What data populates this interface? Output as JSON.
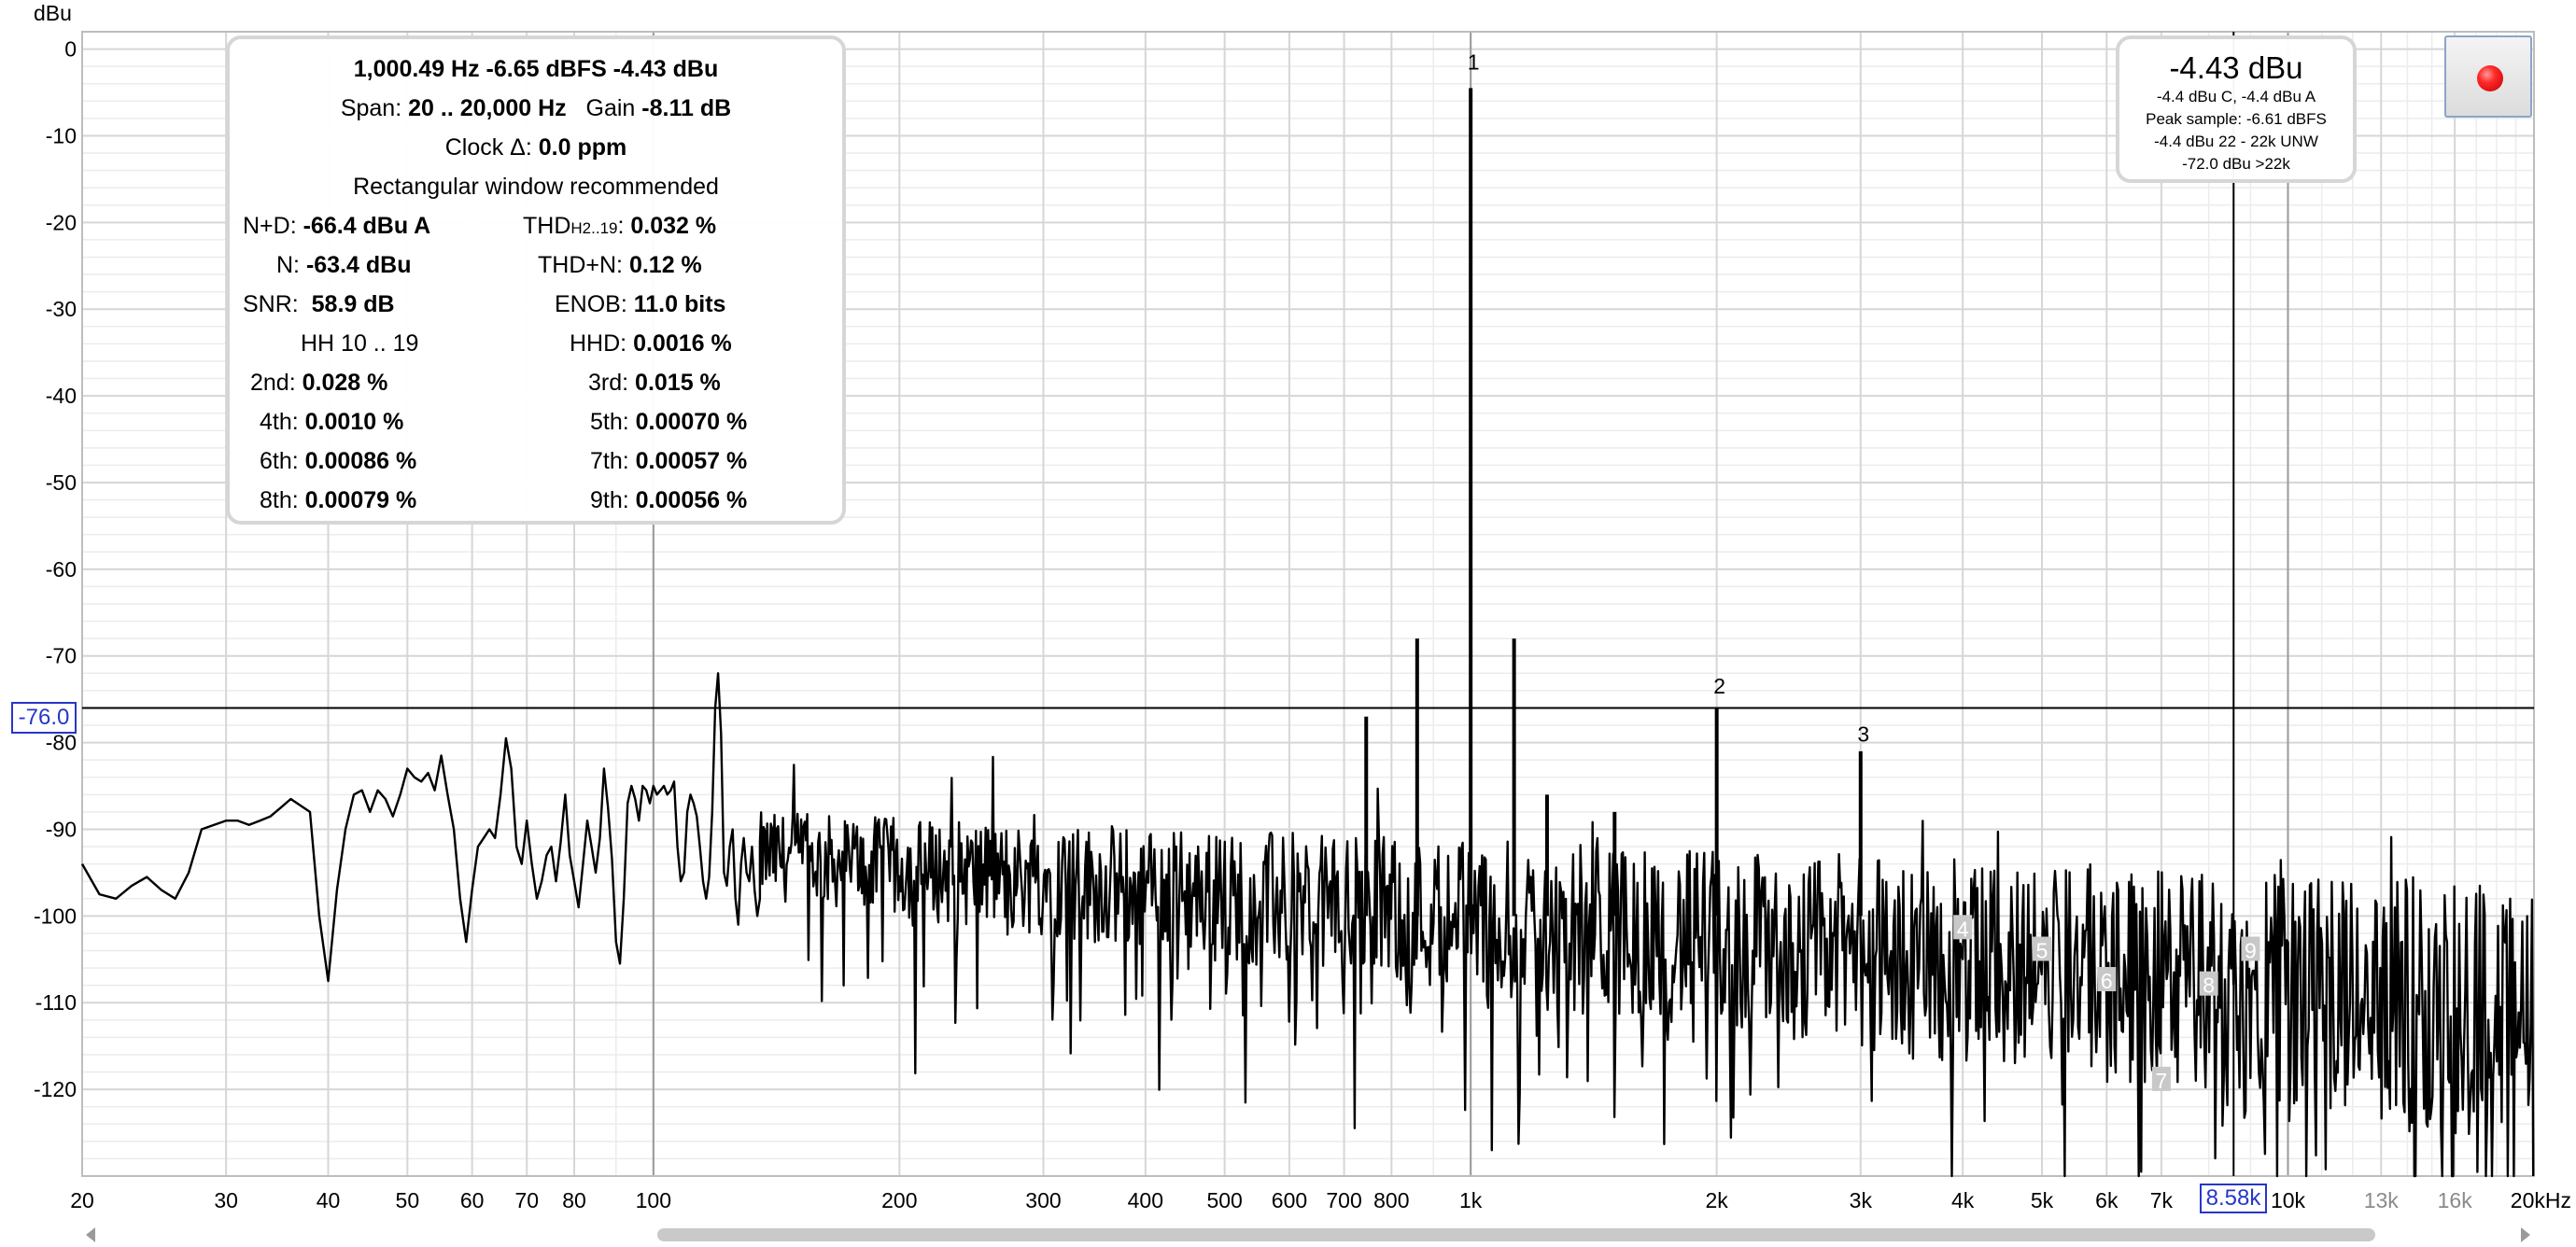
{
  "y_unit": "dBu",
  "stats": {
    "header": "1,000.49 Hz  -6.65 dBFS  -4.43 dBu",
    "span_label": "Span:",
    "span_value": "20 .. 20,000 Hz",
    "gain_label": "Gain",
    "gain_value": "-8.11 dB",
    "clock_label": "Clock Δ:",
    "clock_value": "0.0 ppm",
    "note": "Rectangular window recommended",
    "left": [
      {
        "label": "N+D:",
        "value": "-66.4 dBu A"
      },
      {
        "label": "N:",
        "value": "-63.4 dBu"
      },
      {
        "label": "SNR:",
        "value": "58.9 dB"
      },
      {
        "label": "HH 10 .. 19",
        "value": ""
      },
      {
        "label": "2nd:",
        "value": "0.028 %"
      },
      {
        "label": "4th:",
        "value": "0.0010 %"
      },
      {
        "label": "6th:",
        "value": "0.00086 %"
      },
      {
        "label": "8th:",
        "value": "0.00079 %"
      }
    ],
    "right_thd_label": "THD",
    "right_thd_sub": "H2..19",
    "right_thd_colon": ":",
    "right": [
      {
        "label": "",
        "value": "0.032 %"
      },
      {
        "label": "THD+N:",
        "value": "0.12 %"
      },
      {
        "label": "ENOB:",
        "value": "11.0 bits"
      },
      {
        "label": "HHD:",
        "value": "0.0016 %"
      },
      {
        "label": "3rd:",
        "value": "0.015 %"
      },
      {
        "label": "5th:",
        "value": "0.00070 %"
      },
      {
        "label": "7th:",
        "value": "0.00057 %"
      },
      {
        "label": "9th:",
        "value": "0.00056 %"
      }
    ]
  },
  "meter": {
    "level": "-4.43 dBu",
    "line1": "-4.4 dBu C, -4.4 dBu A",
    "line2": "Peak sample: -6.61 dBFS",
    "line3": "-4.4 dBu 22 - 22k UNW",
    "line4": "-72.0 dBu >22k"
  },
  "cursor": {
    "y_label": "-76.0",
    "x_label": "8.58k",
    "y_value": -76.0,
    "x_value": 8580
  },
  "chart_data": {
    "type": "line",
    "xlabel": "",
    "ylabel": "dBu",
    "xscale": "log",
    "xlim": [
      20,
      20000
    ],
    "ylim": [
      -130,
      2
    ],
    "grid": true,
    "x_ticks": [
      {
        "v": 20,
        "t": "20"
      },
      {
        "v": 30,
        "t": "30"
      },
      {
        "v": 40,
        "t": "40"
      },
      {
        "v": 50,
        "t": "50"
      },
      {
        "v": 60,
        "t": "60"
      },
      {
        "v": 70,
        "t": "70"
      },
      {
        "v": 80,
        "t": "80"
      },
      {
        "v": 100,
        "t": "100"
      },
      {
        "v": 200,
        "t": "200"
      },
      {
        "v": 300,
        "t": "300"
      },
      {
        "v": 400,
        "t": "400"
      },
      {
        "v": 500,
        "t": "500"
      },
      {
        "v": 600,
        "t": "600"
      },
      {
        "v": 700,
        "t": "700"
      },
      {
        "v": 800,
        "t": "800"
      },
      {
        "v": 1000,
        "t": "1k"
      },
      {
        "v": 2000,
        "t": "2k"
      },
      {
        "v": 3000,
        "t": "3k"
      },
      {
        "v": 4000,
        "t": "4k"
      },
      {
        "v": 5000,
        "t": "5k"
      },
      {
        "v": 6000,
        "t": "6k"
      },
      {
        "v": 7000,
        "t": "7k"
      },
      {
        "v": 10000,
        "t": "10k"
      },
      {
        "v": 13000,
        "t": "13k",
        "gray": true
      },
      {
        "v": 16000,
        "t": "16k",
        "gray": true
      },
      {
        "v": 20000,
        "t": "20kHz"
      }
    ],
    "y_ticks": [
      0,
      -10,
      -20,
      -30,
      -40,
      -50,
      -60,
      -70,
      -80,
      -90,
      -100,
      -110,
      -120
    ],
    "harmonic_labels": [
      {
        "n": "1",
        "f": 1000,
        "db": -1.5,
        "boxed": false
      },
      {
        "n": "2",
        "f": 2000,
        "db": -73.5,
        "boxed": false
      },
      {
        "n": "3",
        "f": 3000,
        "db": -79.0,
        "boxed": false
      },
      {
        "n": "4",
        "f": 4000,
        "db": -101.5,
        "boxed": true
      },
      {
        "n": "5",
        "f": 5000,
        "db": -104.0,
        "boxed": true
      },
      {
        "n": "6",
        "f": 6000,
        "db": -107.5,
        "boxed": true
      },
      {
        "n": "7",
        "f": 7000,
        "db": -119.0,
        "boxed": true
      },
      {
        "n": "8",
        "f": 8000,
        "db": -108.0,
        "boxed": true
      },
      {
        "n": "9",
        "f": 9000,
        "db": -104.0,
        "boxed": true
      }
    ],
    "series": [
      {
        "values": [
          [
            20,
            -94
          ],
          [
            21,
            -97.5
          ],
          [
            22,
            -98
          ],
          [
            23,
            -96.5
          ],
          [
            24,
            -95.5
          ],
          [
            25,
            -97
          ],
          [
            26,
            -98
          ],
          [
            27,
            -95
          ],
          [
            28,
            -90
          ],
          [
            29,
            -89.5
          ],
          [
            30,
            -89
          ],
          [
            31,
            -89
          ],
          [
            32,
            -89.5
          ],
          [
            33,
            -89
          ],
          [
            34,
            -88.5
          ],
          [
            35,
            -87.5
          ],
          [
            36,
            -86.5
          ],
          [
            38,
            -88
          ],
          [
            39,
            -100
          ],
          [
            40,
            -107.5
          ],
          [
            41,
            -97
          ],
          [
            42,
            -90
          ],
          [
            43,
            -86
          ],
          [
            44,
            -85.5
          ],
          [
            45,
            -88
          ],
          [
            46,
            -85.5
          ],
          [
            47,
            -86.5
          ],
          [
            48,
            -88.5
          ],
          [
            49,
            -86
          ],
          [
            50,
            -83
          ],
          [
            51,
            -84
          ],
          [
            52,
            -84.5
          ],
          [
            53,
            -83.5
          ],
          [
            54,
            -85.5
          ],
          [
            55,
            -81.5
          ],
          [
            56,
            -86
          ],
          [
            57,
            -90
          ],
          [
            58,
            -98
          ],
          [
            59,
            -103
          ],
          [
            60,
            -97
          ],
          [
            61,
            -92
          ],
          [
            62,
            -91
          ],
          [
            63,
            -90
          ],
          [
            64,
            -91
          ],
          [
            65,
            -86
          ],
          [
            66,
            -79.5
          ],
          [
            67,
            -83
          ],
          [
            68,
            -92
          ],
          [
            69,
            -94
          ],
          [
            70,
            -89
          ],
          [
            71,
            -94
          ],
          [
            72,
            -98
          ],
          [
            73,
            -96
          ],
          [
            74,
            -93
          ],
          [
            75,
            -92
          ],
          [
            76,
            -96
          ],
          [
            77,
            -91.5
          ],
          [
            78,
            -86
          ],
          [
            79,
            -93
          ],
          [
            80,
            -96
          ],
          [
            81,
            -99
          ],
          [
            82,
            -94
          ],
          [
            83,
            -89
          ],
          [
            84,
            -92
          ],
          [
            85,
            -95
          ],
          [
            86,
            -91
          ],
          [
            87,
            -83
          ],
          [
            88,
            -87.5
          ],
          [
            89,
            -93.5
          ],
          [
            90,
            -103
          ],
          [
            91,
            -105.5
          ],
          [
            92,
            -98
          ],
          [
            93,
            -87
          ],
          [
            94,
            -85
          ],
          [
            95,
            -86.5
          ],
          [
            96,
            -89
          ],
          [
            97,
            -85
          ],
          [
            98,
            -85.5
          ],
          [
            99,
            -87
          ],
          [
            100,
            -85
          ],
          [
            101,
            -86
          ],
          [
            102,
            -85.5
          ],
          [
            103,
            -85
          ],
          [
            104,
            -86
          ],
          [
            105,
            -85.5
          ],
          [
            106,
            -84.5
          ],
          [
            107,
            -92
          ],
          [
            108,
            -96
          ],
          [
            109,
            -95
          ],
          [
            110,
            -88
          ],
          [
            111,
            -86
          ],
          [
            112,
            -87
          ],
          [
            113,
            -88.5
          ],
          [
            114,
            -92
          ],
          [
            115,
            -96
          ],
          [
            116,
            -98
          ],
          [
            117,
            -95.5
          ],
          [
            118,
            -88
          ],
          [
            119,
            -76
          ],
          [
            120,
            -72
          ],
          [
            121,
            -79
          ],
          [
            122,
            -95
          ],
          [
            123,
            -96.5
          ],
          [
            124,
            -92
          ],
          [
            125,
            -90
          ],
          [
            126,
            -98
          ],
          [
            127,
            -101
          ],
          [
            128,
            -94
          ],
          [
            129,
            -91
          ],
          [
            130,
            -95
          ],
          [
            131,
            -96
          ],
          [
            132,
            -92
          ],
          [
            133,
            -97
          ],
          [
            134,
            -100
          ],
          [
            135,
            -98
          ]
        ]
      }
    ],
    "noise_floor": {
      "f_start": 135,
      "f_end": 20000,
      "mean_db_start": -93,
      "mean_db_end": -111
    },
    "spikes": [
      {
        "f": 745,
        "db": -77
      },
      {
        "f": 860,
        "db": -68
      },
      {
        "f": 1000,
        "db": -4.5
      },
      {
        "f": 1130,
        "db": -68
      },
      {
        "f": 1240,
        "db": -86
      },
      {
        "f": 1500,
        "db": -88
      },
      {
        "f": 2000,
        "db": -76
      },
      {
        "f": 3000,
        "db": -81
      }
    ]
  }
}
